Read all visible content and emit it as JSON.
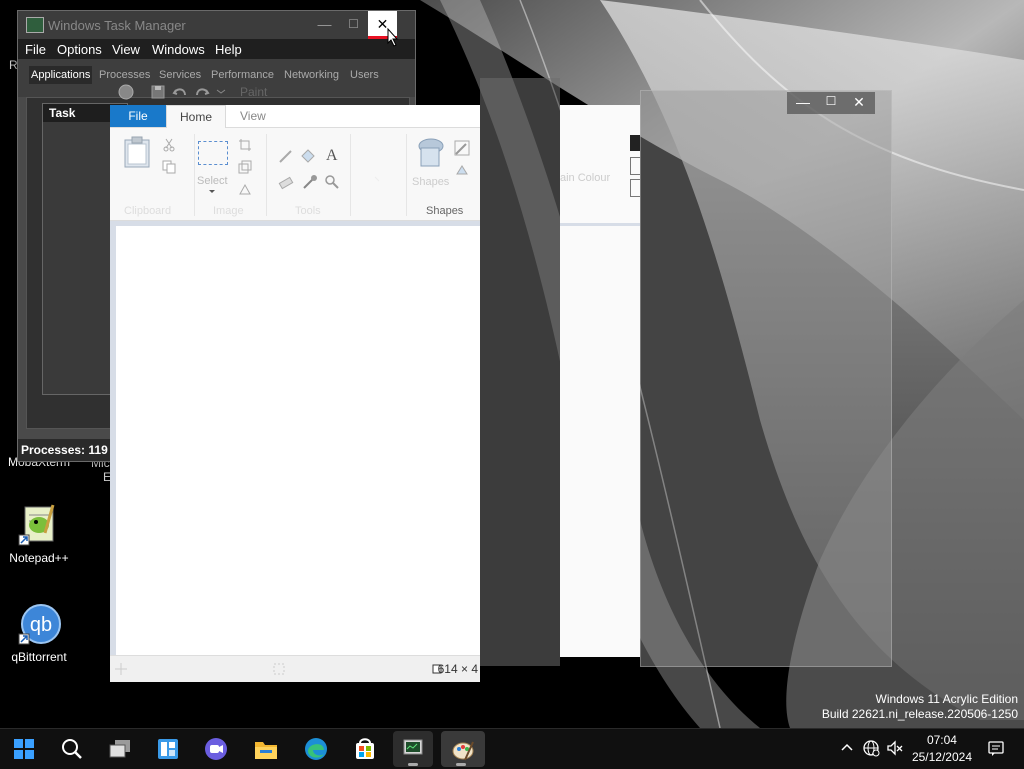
{
  "watermark": {
    "line1": "Windows 11 Acrylic Edition",
    "line2": "Build 22621.ni_release.220506-1250"
  },
  "desktop": {
    "icons": [
      {
        "label": "MobaXterm",
        "icon": "mobaxterm-icon"
      },
      {
        "label": "Notepad++",
        "icon": "notepadpp-icon"
      },
      {
        "label": "qBittorrent",
        "icon": "qbittorrent-icon"
      }
    ],
    "partial_labels": [
      "R",
      "Mic",
      "E"
    ]
  },
  "task_manager": {
    "title": "Windows Task Manager",
    "controls": {
      "minimize": "—",
      "maximize": "☐",
      "close": "✕"
    },
    "menu": [
      "File",
      "Options",
      "View",
      "Windows",
      "Help"
    ],
    "tabs": [
      "Applications",
      "Processes",
      "Services",
      "Performance",
      "Networking",
      "Users"
    ],
    "active_tab": "Applications",
    "table_header": "Task",
    "status": "Processes: 119"
  },
  "paint": {
    "title": "Paint",
    "tabs": {
      "file": "File",
      "home": "Home",
      "view": "View"
    },
    "groups": {
      "clipboard": "Clipboard",
      "image": "Image",
      "tools": "Tools",
      "shapes": "Shapes"
    },
    "select_label": "Select",
    "shapes_label": "Shapes",
    "status_size": "614 × 4"
  },
  "ghost_windows": {
    "partial_text": "ain  Colour",
    "controls": {
      "minimize": "—",
      "maximize": "☐",
      "close": "✕"
    }
  },
  "taskbar": {
    "items": [
      "start-icon",
      "search-icon",
      "task-view-icon",
      "widgets-icon",
      "chat-icon",
      "file-explorer-icon",
      "edge-icon",
      "store-icon",
      "task-manager-icon",
      "paint-icon"
    ],
    "time": "07:04",
    "date": "25/12/2024"
  }
}
